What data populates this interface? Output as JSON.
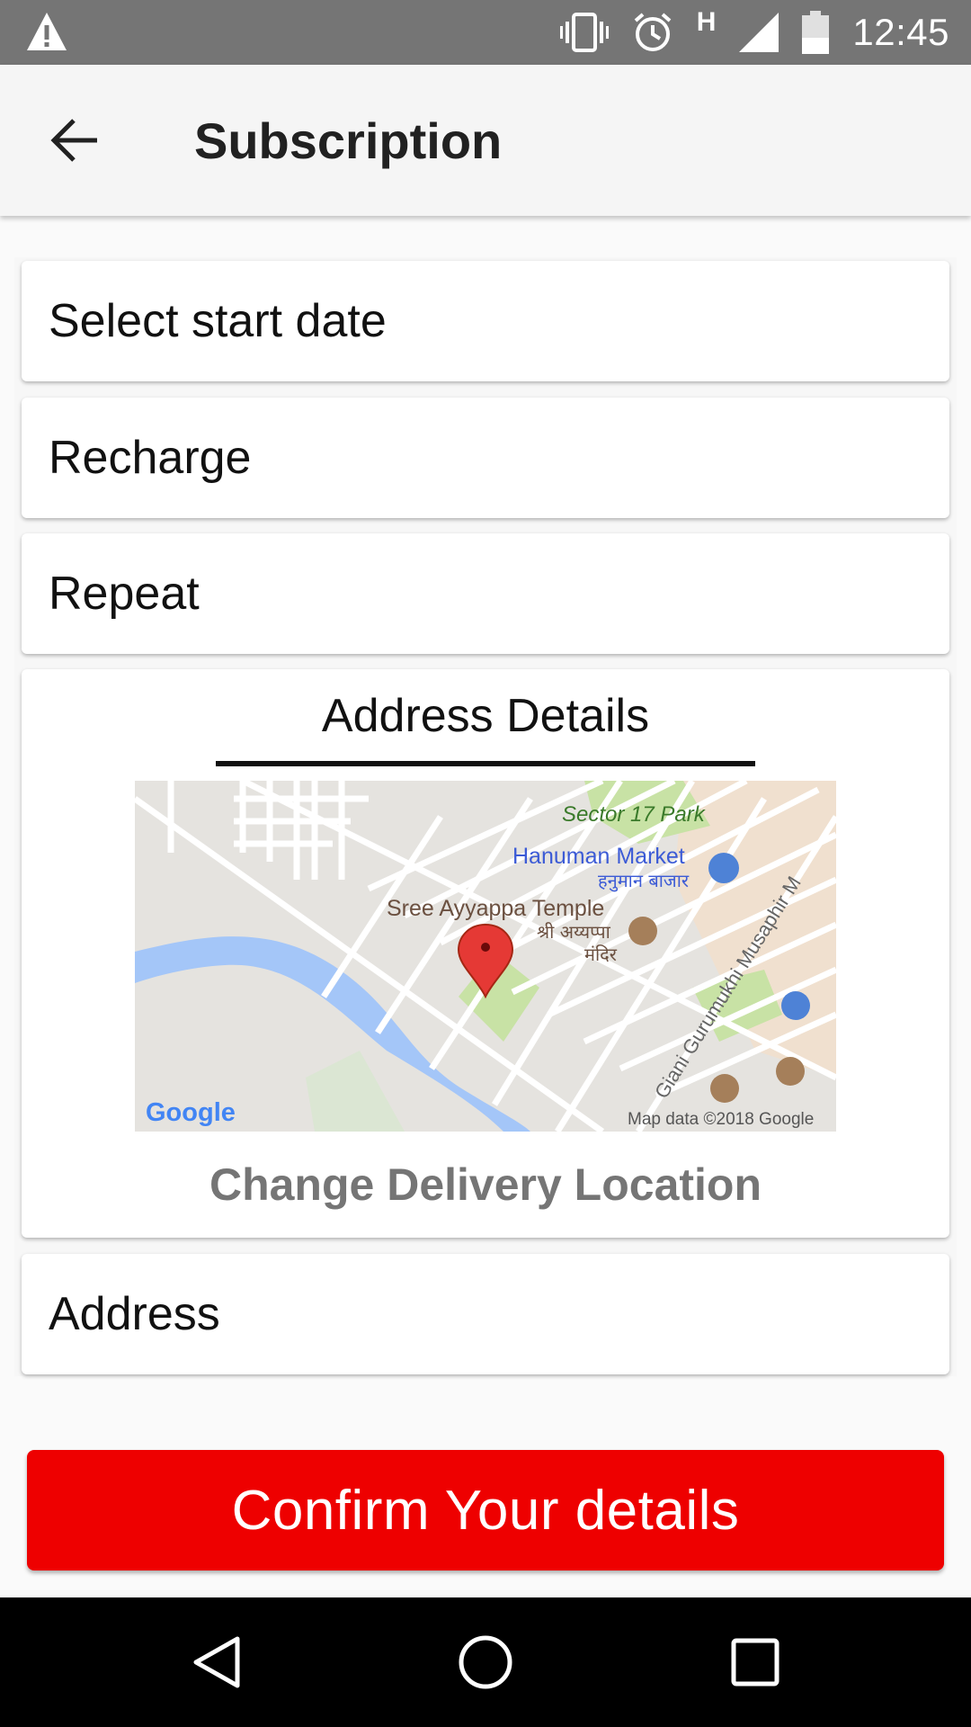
{
  "status_bar": {
    "time": "12:45",
    "network_label": "H",
    "icons": [
      "warning-icon",
      "vibrate-icon",
      "alarm-icon",
      "signal-icon",
      "battery-icon"
    ]
  },
  "app_bar": {
    "title": "Subscription",
    "back_icon": "arrow-back-icon"
  },
  "form": {
    "start_date_label": "Select start date",
    "recharge_label": "Recharge",
    "repeat_label": "Repeat",
    "address_details_title": "Address Details",
    "change_location_label": "Change Delivery Location",
    "address_label": "Address"
  },
  "map": {
    "labels": {
      "park": "Sector 17 Park",
      "market": "Hanuman Market",
      "market_hi": "हनुमान बाजार",
      "temple": "Sree Ayyappa Temple",
      "temple_hi_1": "श्री अय्यप्पा",
      "temple_hi_2": "मंदिर",
      "road": "Giani Gurumukhi Musaphir M",
      "google": "Google",
      "copyright": "Map data ©2018 Google"
    }
  },
  "confirm_button_label": "Confirm Your details",
  "nav_bar": {
    "icons": [
      "back-triangle-icon",
      "home-circle-icon",
      "recents-square-icon"
    ]
  },
  "colors": {
    "accent": "#ee0000",
    "status_bar": "#757575",
    "app_bar": "#f5f5f5",
    "map_water": "#a4c6f8",
    "map_park": "#c8e2a5"
  }
}
